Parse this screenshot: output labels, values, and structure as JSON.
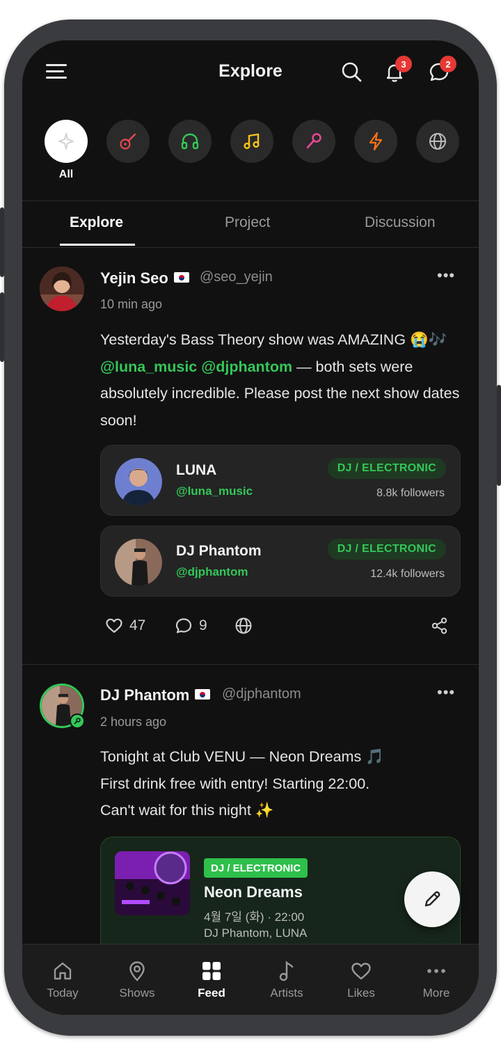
{
  "header": {
    "title": "Explore",
    "notification_count": "3",
    "message_count": "2"
  },
  "categories": [
    {
      "label": "All",
      "icon": "sparkle-icon",
      "color": "#ffffff"
    },
    {
      "icon": "guitar-icon",
      "color": "#e5484d"
    },
    {
      "icon": "headphones-icon",
      "color": "#34c759"
    },
    {
      "icon": "music-note-icon",
      "color": "#f5c518"
    },
    {
      "icon": "microphone-icon",
      "color": "#ec4899"
    },
    {
      "icon": "lightning-icon",
      "color": "#f97316"
    },
    {
      "icon": "globe-icon",
      "color": "#bdbdbd"
    }
  ],
  "tabs": [
    {
      "label": "Explore"
    },
    {
      "label": "Project"
    },
    {
      "label": "Discussion"
    }
  ],
  "posts": [
    {
      "author": "Yejin Seo",
      "handle": "@seo_yejin",
      "time": "10 min ago",
      "text_parts": {
        "a": "Yesterday's Bass Theory show was AMAZING ",
        "emoji": "😭🎶",
        "m1": "@luna_music",
        "m2": "@djphantom",
        "b": " — both sets were absolutely incredible. Please post the next show dates soon!"
      },
      "artists": [
        {
          "name": "LUNA",
          "handle": "@luna_music",
          "genre": "DJ / ELECTRONIC",
          "followers": "8.8k followers"
        },
        {
          "name": "DJ Phantom",
          "handle": "@djphantom",
          "genre": "DJ / ELECTRONIC",
          "followers": "12.4k followers"
        }
      ],
      "likes": "47",
      "comments": "9"
    },
    {
      "author": "DJ Phantom",
      "handle": "@djphantom",
      "time": "2 hours ago",
      "lines": [
        "Tonight at Club VENU — Neon Dreams 🎵",
        "First drink free with entry! Starting 22:00.",
        "Can't wait for this night ✨"
      ],
      "event": {
        "genre": "DJ / ELECTRONIC",
        "title": "Neon Dreams",
        "date": "4월 7일 (화) · 22:00",
        "artists": "DJ Phantom, LUNA"
      }
    }
  ],
  "bottom_nav": [
    {
      "label": "Today",
      "icon": "home-icon"
    },
    {
      "label": "Shows",
      "icon": "location-pin-icon"
    },
    {
      "label": "Feed",
      "icon": "grid-icon",
      "active": true
    },
    {
      "label": "Artists",
      "icon": "music-note-icon"
    },
    {
      "label": "Likes",
      "icon": "heart-icon"
    },
    {
      "label": "More",
      "icon": "more-dots-icon"
    }
  ]
}
